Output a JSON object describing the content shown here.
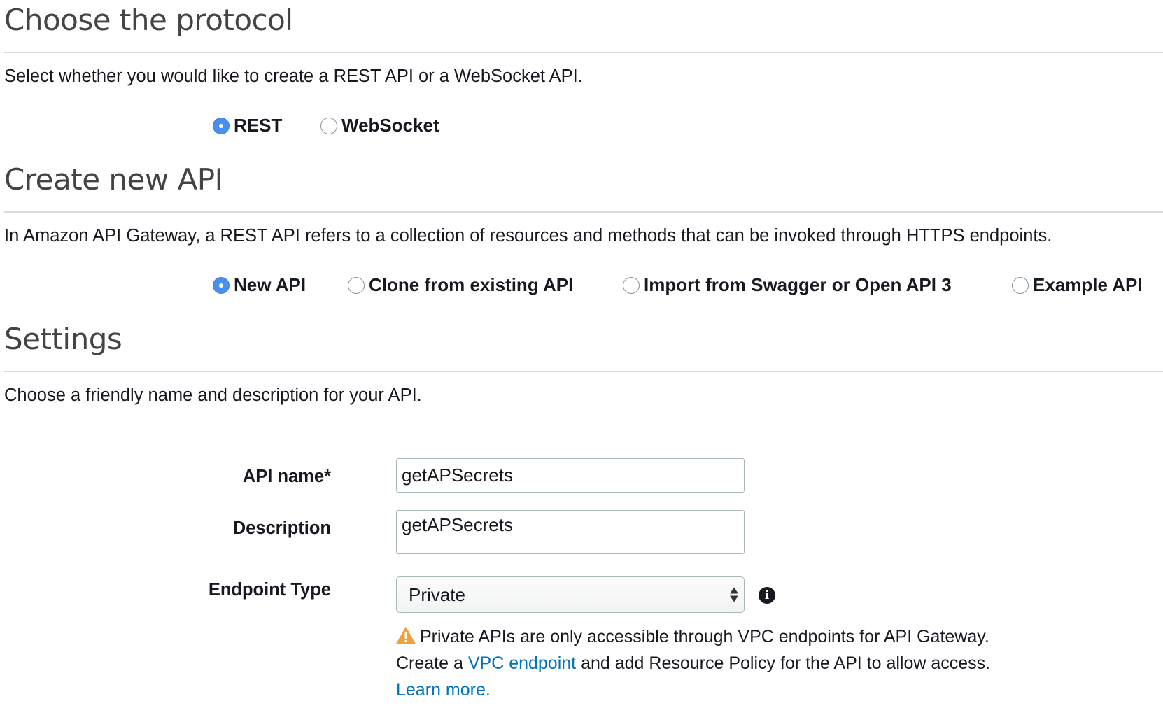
{
  "protocol": {
    "title": "Choose the protocol",
    "description": "Select whether you would like to create a REST API or a WebSocket API.",
    "options": [
      {
        "label": "REST",
        "checked": true
      },
      {
        "label": "WebSocket",
        "checked": false
      }
    ]
  },
  "create": {
    "title": "Create new API",
    "description": "In Amazon API Gateway, a REST API refers to a collection of resources and methods that can be invoked through HTTPS endpoints.",
    "options": [
      {
        "label": "New API",
        "checked": true
      },
      {
        "label": "Clone from existing API",
        "checked": false
      },
      {
        "label": "Import from Swagger or Open API 3",
        "checked": false
      },
      {
        "label": "Example API",
        "checked": false
      }
    ]
  },
  "settings": {
    "title": "Settings",
    "description": "Choose a friendly name and description for your API.",
    "api_name_label": "API name*",
    "api_name_value": "getAPSecrets",
    "description_label": "Description",
    "description_value": "getAPSecrets",
    "endpoint_type_label": "Endpoint Type",
    "endpoint_type_value": "Private",
    "info_icon": "info-icon",
    "warning": {
      "icon": "warning-icon",
      "line1": "Private APIs are only accessible through VPC endpoints for API Gateway.",
      "line2_prefix": "Create a",
      "line2_link": "VPC endpoint",
      "line2_suffix": "and add Resource Policy for the API to allow access.",
      "learn_more": "Learn more."
    }
  },
  "colors": {
    "radio_checked": "#4a8ff0",
    "link": "#0073bb",
    "warning": "#f0a13c",
    "heading": "#444444",
    "rule": "#d5dbdb"
  }
}
